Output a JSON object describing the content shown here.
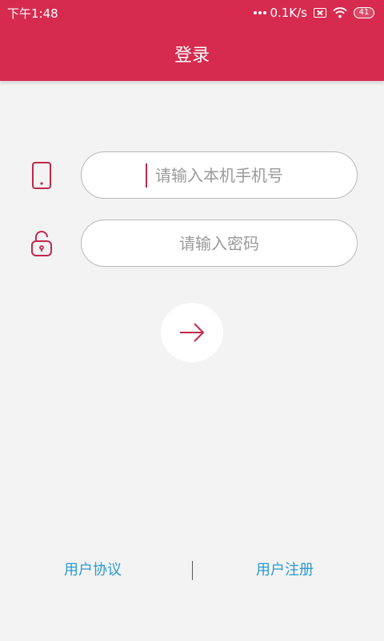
{
  "status_bar": {
    "time": "下午1:48",
    "net_speed": "0.1K/s",
    "battery": "41"
  },
  "app_bar": {
    "title": "登录"
  },
  "form": {
    "phone": {
      "placeholder": "请输入本机手机号",
      "value": "",
      "icon": "phone-icon"
    },
    "password": {
      "placeholder": "请输入密码",
      "value": "",
      "icon": "unlock-icon"
    },
    "submit_icon": "arrow-right-icon"
  },
  "footer": {
    "agreement": "用户协议",
    "register": "用户注册"
  },
  "colors": {
    "primary": "#d62b4f",
    "link": "#2a9ad3",
    "background": "#f3f3f3"
  }
}
